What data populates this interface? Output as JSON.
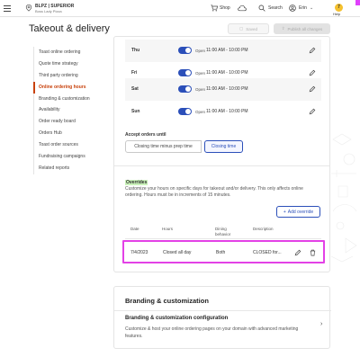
{
  "topbar": {
    "location_name": "BLPZ | SUPERIOR",
    "location_sub": "Boss Lady Pizza",
    "shop_label": "Shop",
    "search_label": "Search",
    "user_label": "Erin",
    "help_label": "Help",
    "help_badge": "7"
  },
  "header": {
    "title": "Takeout & delivery",
    "saved_label": "Saved",
    "publish_label": "Publish all changes"
  },
  "sidenav": {
    "items": [
      "Toast online ordering",
      "Quote time strategy",
      "Third party ordering",
      "Online ordering hours",
      "Branding & customization",
      "Availability",
      "Order ready board",
      "Orders Hub",
      "Toast order sources",
      "Fundraising campaigns",
      "Related reports"
    ],
    "active_index": 3
  },
  "schedule": {
    "open_label": "Open",
    "days": [
      {
        "name": "Thu",
        "open": true,
        "hours": "11:00 AM  -  10:00 PM"
      },
      {
        "name": "Fri",
        "open": true,
        "hours": "11:00 AM  -  10:00 PM"
      },
      {
        "name": "Sat",
        "open": true,
        "hours": "11:00 AM  -  10:00 PM"
      },
      {
        "name": "Sun",
        "open": true,
        "hours": "11:00 AM  -  10:00 PM"
      }
    ]
  },
  "accept": {
    "label": "Accept orders until",
    "option_a": "Closing time minus prep time",
    "option_b": "Closing time",
    "selected": "Closing time"
  },
  "overrides": {
    "title": "Overrides",
    "description": "Customize your hours on specific days for takeout and/or delivery. This only affects online ordering. Hours must be in increments of 15 minutes.",
    "add_label": "Add override",
    "columns": [
      "Date",
      "Hours",
      "Dining behavior",
      "Description"
    ],
    "rows": [
      {
        "date": "7/4/2023",
        "hours": "Closed all day",
        "dining": "Both",
        "description": "CLOSED for..."
      }
    ]
  },
  "branding": {
    "title": "Branding & customization",
    "subtitle": "Branding & customization configuration",
    "description": "Customize & host your online ordering pages on your domain with advanced marketing features."
  },
  "colors": {
    "accent": "#2b4fb9",
    "active_nav": "#c8410b",
    "highlight": "#e341e6",
    "overrides_highlight": "#c9f2b9"
  }
}
